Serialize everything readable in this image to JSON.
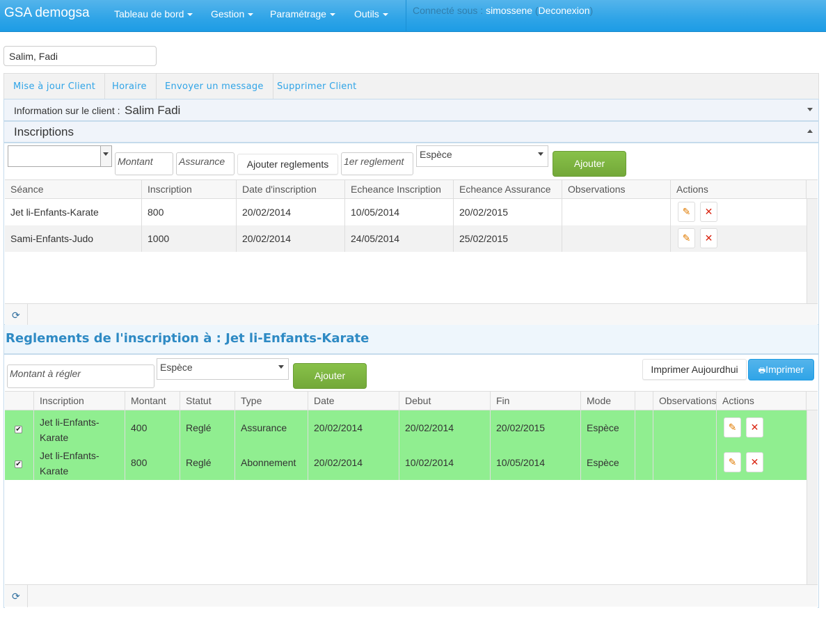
{
  "navbar": {
    "brand": "GSA demogsa",
    "menu": [
      "Tableau de bord",
      "Gestion",
      "Paramétrage",
      "Outils"
    ],
    "connected_label": "Connecté sous :",
    "username": "simossene",
    "logout": "Deconexion"
  },
  "client_input": {
    "value": "Salim, Fadi"
  },
  "tabs": [
    "Mise à jour Client",
    "Horaire",
    "Envoyer un message",
    "Supprimer Client"
  ],
  "client_info": {
    "label": "Information sur le client :",
    "name": "Salim Fadi"
  },
  "inscriptions": {
    "title": "Inscriptions",
    "form": {
      "montant_placeholder": "Montant",
      "assurance_placeholder": "Assurance",
      "ajouter_reglements": "Ajouter reglements",
      "premier_reglement_placeholder": "1er reglement",
      "mode": "Espèce",
      "ajouter": "Ajouter"
    },
    "columns": [
      "Séance",
      "Inscription",
      "Date d'inscription",
      "Echeance Inscription",
      "Echeance Assurance",
      "Observations",
      "Actions"
    ],
    "rows": [
      [
        "Jet li-Enfants-Karate",
        "800",
        "20/02/2014",
        "10/05/2014",
        "20/02/2015",
        ""
      ],
      [
        "Sami-Enfants-Judo",
        "1000",
        "20/02/2014",
        "24/05/2014",
        "25/02/2015",
        ""
      ]
    ]
  },
  "reglements": {
    "title": "Reglements de l'inscription à : Jet li-Enfants-Karate",
    "form": {
      "montant_placeholder": "Montant à régler",
      "mode": "Espèce",
      "ajouter": "Ajouter",
      "imprimer_aujourdhui": "Imprimer Aujourdhui",
      "imprimer": "Imprimer"
    },
    "columns": [
      "Inscription",
      "Montant",
      "Statut",
      "Type",
      "Date",
      "Debut",
      "Fin",
      "Mode",
      "",
      "Observations",
      "Actions"
    ],
    "rows": [
      {
        "checked": true,
        "inscription_l1": "Jet li-Enfants-",
        "inscription_l2": "Karate",
        "montant": "400",
        "statut": "Reglé",
        "type": "Assurance",
        "date": "20/02/2014",
        "debut": "20/02/2014",
        "fin": "20/02/2015",
        "mode": "Espèce",
        "observations": ""
      },
      {
        "checked": true,
        "inscription_l1": "Jet li-Enfants-",
        "inscription_l2": "Karate",
        "montant": "800",
        "statut": "Reglé",
        "type": "Abonnement",
        "date": "20/02/2014",
        "debut": "10/02/2014",
        "fin": "10/05/2014",
        "mode": "Espèce",
        "observations": ""
      }
    ],
    "row_color": "#90ee90"
  },
  "icons": {
    "edit": "pencil-icon",
    "delete": "cross-icon",
    "refresh": "refresh-icon",
    "print": "printer-icon"
  }
}
